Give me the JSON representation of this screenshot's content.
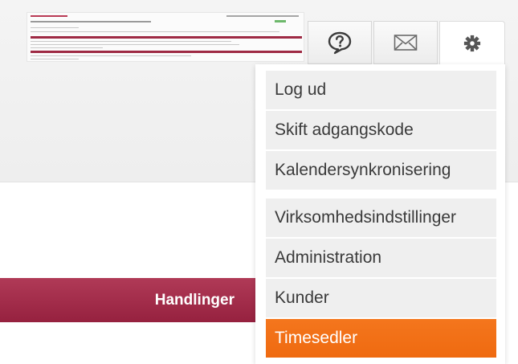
{
  "topbar": {
    "help_icon": "question-bubble-icon",
    "mail_icon": "envelope-icon",
    "settings_icon": "gear-icon"
  },
  "menu": {
    "items": [
      {
        "label": "Log ud"
      },
      {
        "label": "Skift adgangskode"
      },
      {
        "label": "Kalendersynkronisering"
      },
      {
        "label": "Virksomhedsindstillinger"
      },
      {
        "label": "Administration"
      },
      {
        "label": "Kunder"
      },
      {
        "label": "Timesedler",
        "active": true
      }
    ]
  },
  "actions": {
    "label": "Handlinger"
  },
  "colors": {
    "accent_orange": "#f0700f",
    "brand_red": "#a3304c",
    "menu_item_bg": "#efefef"
  }
}
